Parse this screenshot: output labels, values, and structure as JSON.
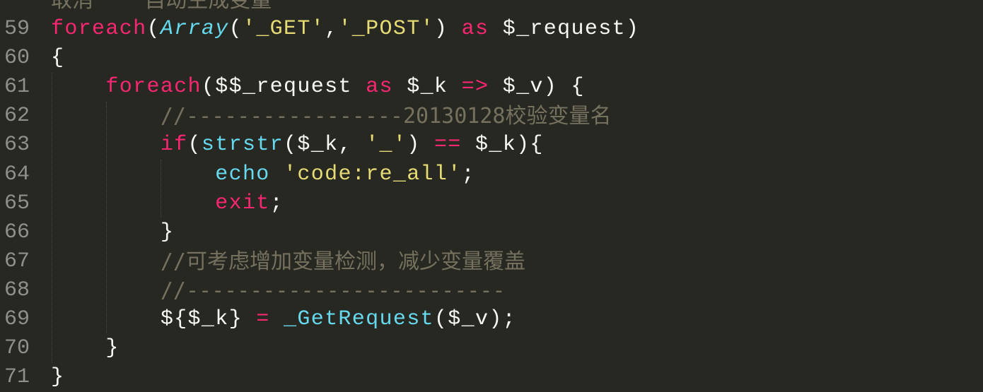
{
  "colors": {
    "background": "#272822",
    "text": "#f8f8f2",
    "keyword": "#f92672",
    "function": "#66d9ef",
    "string": "#e6db74",
    "comment": "#75715e",
    "gutter": "#90908a"
  },
  "editor": {
    "partial_top_line": "取消    自动生成变量",
    "lines": [
      {
        "number": "59",
        "tokens": [
          {
            "t": "kw",
            "v": "foreach"
          },
          {
            "t": "plain",
            "v": "("
          },
          {
            "t": "cls",
            "v": "Array"
          },
          {
            "t": "plain",
            "v": "("
          },
          {
            "t": "str",
            "v": "'_GET'"
          },
          {
            "t": "plain",
            "v": ","
          },
          {
            "t": "str",
            "v": "'_POST'"
          },
          {
            "t": "plain",
            "v": ") "
          },
          {
            "t": "kw",
            "v": "as"
          },
          {
            "t": "plain",
            "v": " $_request)"
          }
        ]
      },
      {
        "number": "60",
        "tokens": [
          {
            "t": "plain",
            "v": "{"
          }
        ]
      },
      {
        "number": "61",
        "tokens": [
          {
            "t": "plain",
            "v": "    "
          },
          {
            "t": "kw",
            "v": "foreach"
          },
          {
            "t": "plain",
            "v": "($$_request "
          },
          {
            "t": "kw",
            "v": "as"
          },
          {
            "t": "plain",
            "v": " $_k "
          },
          {
            "t": "kw",
            "v": "=>"
          },
          {
            "t": "plain",
            "v": " $_v) {"
          }
        ]
      },
      {
        "number": "62",
        "tokens": [
          {
            "t": "plain",
            "v": "        "
          },
          {
            "t": "cm",
            "v": "//-----------------20130128校验变量名"
          }
        ]
      },
      {
        "number": "63",
        "tokens": [
          {
            "t": "plain",
            "v": "        "
          },
          {
            "t": "kw",
            "v": "if"
          },
          {
            "t": "plain",
            "v": "("
          },
          {
            "t": "fn",
            "v": "strstr"
          },
          {
            "t": "plain",
            "v": "($_k, "
          },
          {
            "t": "str",
            "v": "'_'"
          },
          {
            "t": "plain",
            "v": ") "
          },
          {
            "t": "kw",
            "v": "=="
          },
          {
            "t": "plain",
            "v": " $_k){"
          }
        ]
      },
      {
        "number": "64",
        "tokens": [
          {
            "t": "plain",
            "v": "            "
          },
          {
            "t": "fn",
            "v": "echo"
          },
          {
            "t": "plain",
            "v": " "
          },
          {
            "t": "str",
            "v": "'code:re_all'"
          },
          {
            "t": "plain",
            "v": ";"
          }
        ]
      },
      {
        "number": "65",
        "tokens": [
          {
            "t": "plain",
            "v": "            "
          },
          {
            "t": "kw",
            "v": "exit"
          },
          {
            "t": "plain",
            "v": ";"
          }
        ]
      },
      {
        "number": "66",
        "tokens": [
          {
            "t": "plain",
            "v": "        }"
          }
        ]
      },
      {
        "number": "67",
        "tokens": [
          {
            "t": "plain",
            "v": "        "
          },
          {
            "t": "cm",
            "v": "//可考虑增加变量检测，减少变量覆盖"
          }
        ]
      },
      {
        "number": "68",
        "tokens": [
          {
            "t": "plain",
            "v": "        "
          },
          {
            "t": "cm",
            "v": "//-------------------------"
          }
        ]
      },
      {
        "number": "69",
        "tokens": [
          {
            "t": "plain",
            "v": "        ${$_k} "
          },
          {
            "t": "kw",
            "v": "="
          },
          {
            "t": "plain",
            "v": " "
          },
          {
            "t": "fn",
            "v": "_GetRequest"
          },
          {
            "t": "plain",
            "v": "($_v);"
          }
        ]
      },
      {
        "number": "70",
        "tokens": [
          {
            "t": "plain",
            "v": "    }"
          }
        ]
      },
      {
        "number": "71",
        "tokens": [
          {
            "t": "plain",
            "v": "}"
          }
        ]
      }
    ]
  }
}
